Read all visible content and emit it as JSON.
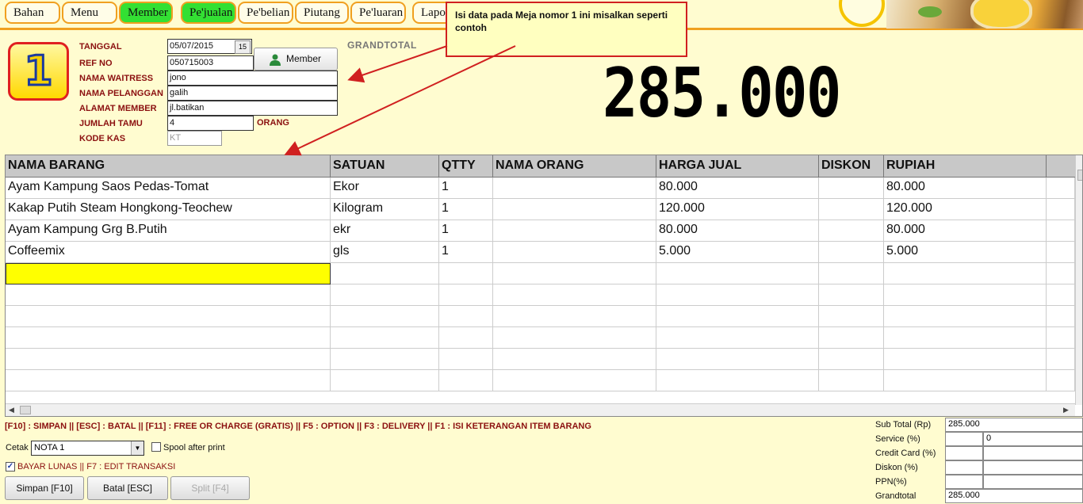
{
  "menu": {
    "tabs": [
      {
        "label": "Bahan",
        "active": false
      },
      {
        "label": "Menu",
        "active": false
      },
      {
        "label": "Member",
        "active": true
      },
      {
        "label": "Pe'jualan",
        "active": true
      },
      {
        "label": "Pe'belian",
        "active": false
      },
      {
        "label": "Piutang",
        "active": false
      },
      {
        "label": "Pe'luaran",
        "active": false
      },
      {
        "label": "Lapo",
        "active": false
      }
    ]
  },
  "callout": {
    "text": "Isi data pada Meja nomor 1 ini misalkan seperti contoh"
  },
  "table_number": "1",
  "form": {
    "tanggal_label": "TANGGAL",
    "tanggal": "05/07/2015",
    "date_btn": "15",
    "refno_label": "REF NO",
    "refno": "050715003",
    "waitress_label": "NAMA WAITRESS",
    "waitress": "jono",
    "pelanggan_label": "NAMA PELANGGAN",
    "pelanggan": "galih",
    "alamat_label": "ALAMAT MEMBER",
    "alamat": "jl.batikan",
    "tamu_label": "JUMLAH TAMU",
    "tamu": "4",
    "orang": "ORANG",
    "kodekas_label": "KODE KAS",
    "kodekas": "KT",
    "member_button": "Member"
  },
  "grandtotal": {
    "label": "GRANDTOTAL",
    "value": "285.000"
  },
  "grid": {
    "headers": [
      "NAMA BARANG",
      "SATUAN",
      "QTTY",
      "NAMA ORANG",
      "HARGA JUAL",
      "DISKON",
      "RUPIAH"
    ],
    "rows": [
      [
        "Ayam Kampung Saos Pedas-Tomat",
        "Ekor",
        "1",
        "",
        "80.000",
        "",
        "80.000"
      ],
      [
        "Kakap Putih Steam Hongkong-Teochew",
        "Kilogram",
        "1",
        "",
        "120.000",
        "",
        "120.000"
      ],
      [
        "Ayam Kampung Grg B.Putih",
        "ekr",
        "1",
        "",
        "80.000",
        "",
        "80.000"
      ],
      [
        "Coffeemix",
        "gls",
        "1",
        "",
        "5.000",
        "",
        "5.000"
      ],
      [
        "",
        "",
        "",
        "",
        "",
        "",
        ""
      ],
      [
        "",
        "",
        "",
        "",
        "",
        "",
        ""
      ],
      [
        "",
        "",
        "",
        "",
        "",
        "",
        ""
      ],
      [
        "",
        "",
        "",
        "",
        "",
        "",
        ""
      ],
      [
        "",
        "",
        "",
        "",
        "",
        "",
        ""
      ],
      [
        "",
        "",
        "",
        "",
        "",
        "",
        ""
      ]
    ]
  },
  "footer": {
    "shortcuts": "[F10] : SIMPAN  ||  [ESC] : BATAL || [F11]  : FREE OR CHARGE (GRATIS) || F5 : OPTION || F3 : DELIVERY || F1 : ISI KETERANGAN ITEM BARANG",
    "cetak_label": "Cetak",
    "cetak_value": "NOTA 1",
    "spool_label": "Spool after print",
    "spool_checked": false,
    "lunas_label": "BAYAR LUNAS || F7 : EDIT TRANSAKSI",
    "lunas_checked": true,
    "simpan_button": "Simpan [F10]",
    "batal_button": "Batal [ESC]",
    "split_button": "Split [F4]"
  },
  "summary": {
    "subtotal_label": "Sub Total (Rp)",
    "subtotal": "285.000",
    "service_label": "Service (%)",
    "service": "",
    "service_amount": "0",
    "credit_label": "Credit Card (%)",
    "credit": "",
    "credit_amount": "",
    "diskon_label": "Diskon (%)",
    "diskon": "",
    "diskon_amount": "",
    "ppn_label": "PPN(%)",
    "ppn": "",
    "ppn_amount": "",
    "grandtotal_label": "Grandtotal",
    "grandtotal": "285.000"
  },
  "colors": {
    "accent_orange": "#f0a020",
    "active_tab": "#33e033",
    "label_red": "#8b1010",
    "active_cell": "#ffff00"
  }
}
